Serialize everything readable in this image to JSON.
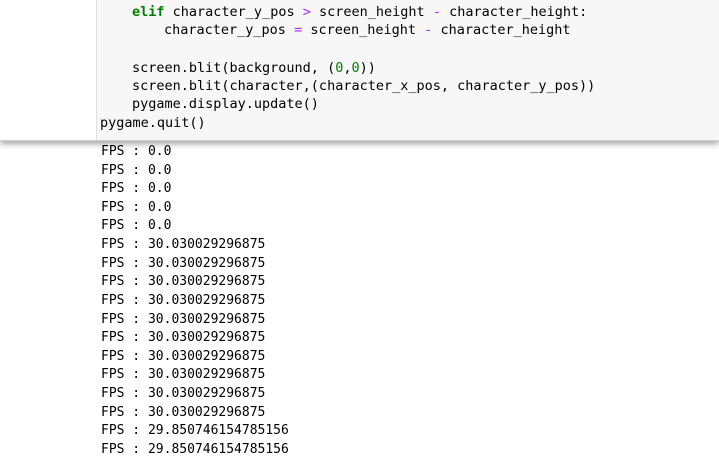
{
  "code": {
    "line1": {
      "kw": "elif",
      "a": "character_y_pos",
      "op": ">",
      "b": "screen_height",
      "op2": "-",
      "c": "character_height:"
    },
    "line2": {
      "a": "character_y_pos",
      "op": "=",
      "b": "screen_height",
      "op2": "-",
      "c": "character_height"
    },
    "line4": {
      "pre": "screen.blit(background, (",
      "n1": "0",
      "comma": ",",
      "n2": "0",
      "post": "))"
    },
    "line5": "screen.blit(character,(character_x_pos, character_y_pos))",
    "line6": "pygame.display.update()",
    "line7": "pygame.quit()"
  },
  "output": {
    "lines": [
      "FPS : 0.0",
      "FPS : 0.0",
      "FPS : 0.0",
      "FPS : 0.0",
      "FPS : 0.0",
      "FPS : 30.030029296875",
      "FPS : 30.030029296875",
      "FPS : 30.030029296875",
      "FPS : 30.030029296875",
      "FPS : 30.030029296875",
      "FPS : 30.030029296875",
      "FPS : 30.030029296875",
      "FPS : 30.030029296875",
      "FPS : 30.030029296875",
      "FPS : 30.030029296875",
      "FPS : 29.850746154785156",
      "FPS : 29.850746154785156"
    ]
  }
}
